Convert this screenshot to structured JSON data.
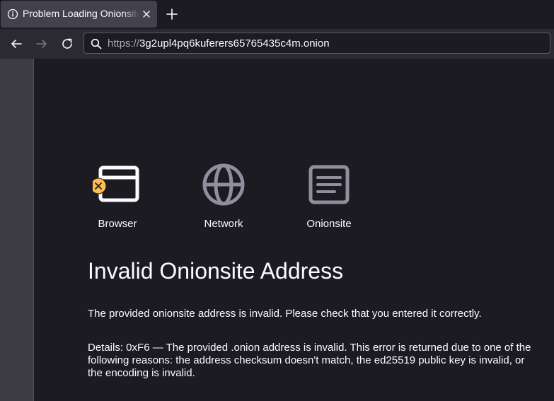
{
  "tab": {
    "title": "Problem Loading Onionsite",
    "close_icon": "close-icon",
    "info_icon": "info-icon"
  },
  "toolbar": {
    "back_icon": "back-arrow-icon",
    "forward_icon": "forward-arrow-icon",
    "reload_icon": "reload-icon",
    "new_tab_icon": "plus-icon"
  },
  "urlbar": {
    "scheme": "https://",
    "host": "3g2upl4pq6kuferers65765435c4m.onion",
    "search_icon": "search-icon"
  },
  "diagnostic": {
    "items": [
      {
        "label": "Browser",
        "icon": "browser-window-icon",
        "status": "error"
      },
      {
        "label": "Network",
        "icon": "globe-icon",
        "status": "ok"
      },
      {
        "label": "Onionsite",
        "icon": "document-icon",
        "status": "ok"
      }
    ],
    "error_color": "#ffbd4f",
    "icon_color": "#8f8f9d"
  },
  "error": {
    "title": "Invalid Onionsite Address",
    "description": "The provided onionsite address is invalid. Please check that you entered it correctly.",
    "details": "Details: 0xF6 — The provided .onion address is invalid. This error is returned due to one of the following reasons: the address checksum doesn't match, the ed25519 public key is invalid, or the encoding is invalid."
  }
}
